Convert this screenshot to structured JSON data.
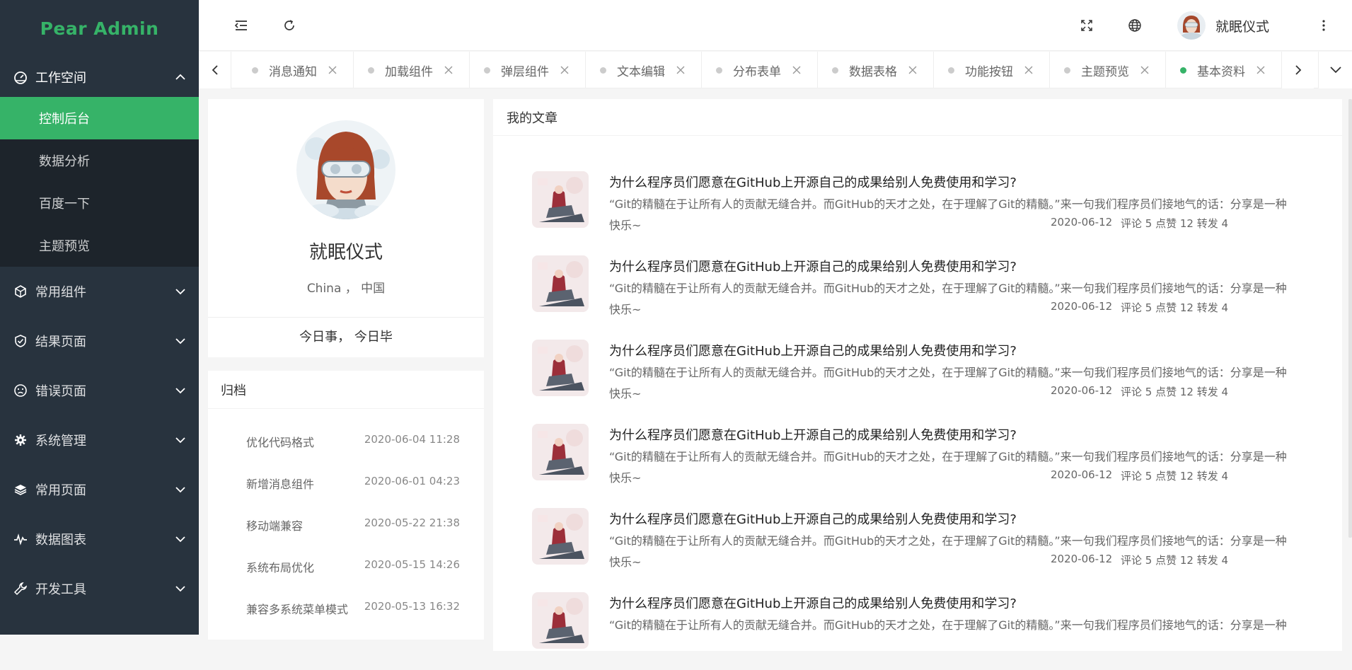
{
  "app": {
    "logo_text": "Pear Admin"
  },
  "colors": {
    "brand": "#36b368",
    "sidebar_bg": "#28333e",
    "submenu_bg": "#1d242b",
    "inactive_dot": "#cccccc"
  },
  "sidebar": {
    "groups": [
      {
        "label": "工作空间",
        "icon": "dashboard-icon",
        "expanded": true,
        "items": [
          {
            "label": "控制后台",
            "active": true
          },
          {
            "label": "数据分析",
            "active": false
          },
          {
            "label": "百度一下",
            "active": false
          },
          {
            "label": "主题预览",
            "active": false
          }
        ]
      }
    ],
    "items": [
      {
        "label": "常用组件",
        "icon": "cube-icon"
      },
      {
        "label": "结果页面",
        "icon": "shield-check-icon"
      },
      {
        "label": "错误页面",
        "icon": "face-icon"
      },
      {
        "label": "系统管理",
        "icon": "gear-icon"
      },
      {
        "label": "常用页面",
        "icon": "layers-icon"
      },
      {
        "label": "数据图表",
        "icon": "pulse-icon"
      },
      {
        "label": "开发工具",
        "icon": "tool-icon"
      }
    ]
  },
  "header": {
    "username": "就眠仪式"
  },
  "tabs": [
    {
      "label": "消息通知",
      "active": false
    },
    {
      "label": "加载组件",
      "active": false
    },
    {
      "label": "弹层组件",
      "active": false
    },
    {
      "label": "文本编辑",
      "active": false
    },
    {
      "label": "分布表单",
      "active": false
    },
    {
      "label": "数据表格",
      "active": false
    },
    {
      "label": "功能按钮",
      "active": false
    },
    {
      "label": "主题预览",
      "active": false
    },
    {
      "label": "基本资料",
      "active": true
    }
  ],
  "profile": {
    "name": "就眠仪式",
    "location": "China ，  中国",
    "motto": "今日事， 今日毕"
  },
  "archive": {
    "title": "归档",
    "items": [
      {
        "name": "优化代码格式",
        "time": "2020-06-04 11:28"
      },
      {
        "name": "新增消息组件",
        "time": "2020-06-01 04:23"
      },
      {
        "name": "移动端兼容",
        "time": "2020-05-22 21:38"
      },
      {
        "name": "系统布局优化",
        "time": "2020-05-15 14:26"
      },
      {
        "name": "兼容多系统菜单模式",
        "time": "2020-05-13 16:32"
      }
    ]
  },
  "articles": {
    "title": "我的文章",
    "items": [
      {
        "title": "为什么程序员们愿意在GitHub上开源自己的成果给别人免费使用和学习?",
        "desc": "“Git的精髓在于让所有人的贡献无缝合并。而GitHub的天才之处，在于理解了Git的精髓。”来一句我们程序员们接地气的话：分享是一种",
        "desc2": "快乐~",
        "date": "2020-06-12",
        "meta": "评论 5 点赞 12 转发 4"
      },
      {
        "title": "为什么程序员们愿意在GitHub上开源自己的成果给别人免费使用和学习?",
        "desc": "“Git的精髓在于让所有人的贡献无缝合并。而GitHub的天才之处，在于理解了Git的精髓。”来一句我们程序员们接地气的话：分享是一种",
        "desc2": "快乐~",
        "date": "2020-06-12",
        "meta": "评论 5 点赞 12 转发 4"
      },
      {
        "title": "为什么程序员们愿意在GitHub上开源自己的成果给别人免费使用和学习?",
        "desc": "“Git的精髓在于让所有人的贡献无缝合并。而GitHub的天才之处，在于理解了Git的精髓。”来一句我们程序员们接地气的话：分享是一种",
        "desc2": "快乐~",
        "date": "2020-06-12",
        "meta": "评论 5 点赞 12 转发 4"
      },
      {
        "title": "为什么程序员们愿意在GitHub上开源自己的成果给别人免费使用和学习?",
        "desc": "“Git的精髓在于让所有人的贡献无缝合并。而GitHub的天才之处，在于理解了Git的精髓。”来一句我们程序员们接地气的话：分享是一种",
        "desc2": "快乐~",
        "date": "2020-06-12",
        "meta": "评论 5 点赞 12 转发 4"
      },
      {
        "title": "为什么程序员们愿意在GitHub上开源自己的成果给别人免费使用和学习?",
        "desc": "“Git的精髓在于让所有人的贡献无缝合并。而GitHub的天才之处，在于理解了Git的精髓。”来一句我们程序员们接地气的话：分享是一种",
        "desc2": "快乐~",
        "date": "2020-06-12",
        "meta": "评论 5 点赞 12 转发 4"
      },
      {
        "title": "为什么程序员们愿意在GitHub上开源自己的成果给别人免费使用和学习?",
        "desc": "“Git的精髓在于让所有人的贡献无缝合并。而GitHub的天才之处，在于理解了Git的精髓。”来一句我们程序员们接地气的话：分享是一种",
        "desc2": "",
        "date": "",
        "meta": ""
      }
    ]
  }
}
